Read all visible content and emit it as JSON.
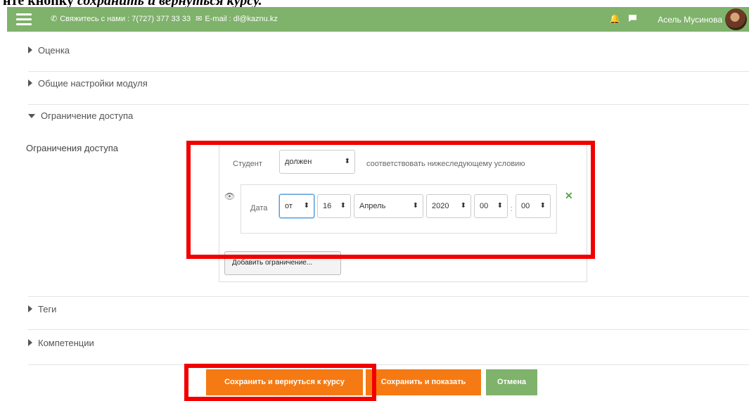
{
  "caption": {
    "prefix": "нте кнопку ",
    "italic": "сохранить и вернуться курсу."
  },
  "navbar": {
    "contact_text": "Свяжитесь с нами : 7(727) 377 33 33",
    "email_text": "E-mail : dl@kaznu.kz",
    "username": "Асель Мусинова",
    "color": "#7fb26b"
  },
  "sections": {
    "grading": "Оценка",
    "common_settings": "Общие настройки модуля",
    "restrict_access": "Ограничение доступа",
    "tags": "Теги",
    "competencies": "Компетенции"
  },
  "restrictions": {
    "label": "Ограничения доступа",
    "student_label": "Студент",
    "must_value": "должен",
    "match_text": "соответствовать нижеследующему условию",
    "date_label": "Дата",
    "direction": "от",
    "day": "16",
    "month": "Апрель",
    "year": "2020",
    "hour": "00",
    "colon": ":",
    "minute": "00",
    "add_button": "Добавить ограничение..."
  },
  "actions": {
    "save_return": "Сохранить и вернуться к курсу",
    "save_display": "Сохранить и показать",
    "cancel": "Отмена",
    "primary_color": "#f57a13",
    "cancel_color": "#7fb26b"
  },
  "highlight_color": "#f20000"
}
